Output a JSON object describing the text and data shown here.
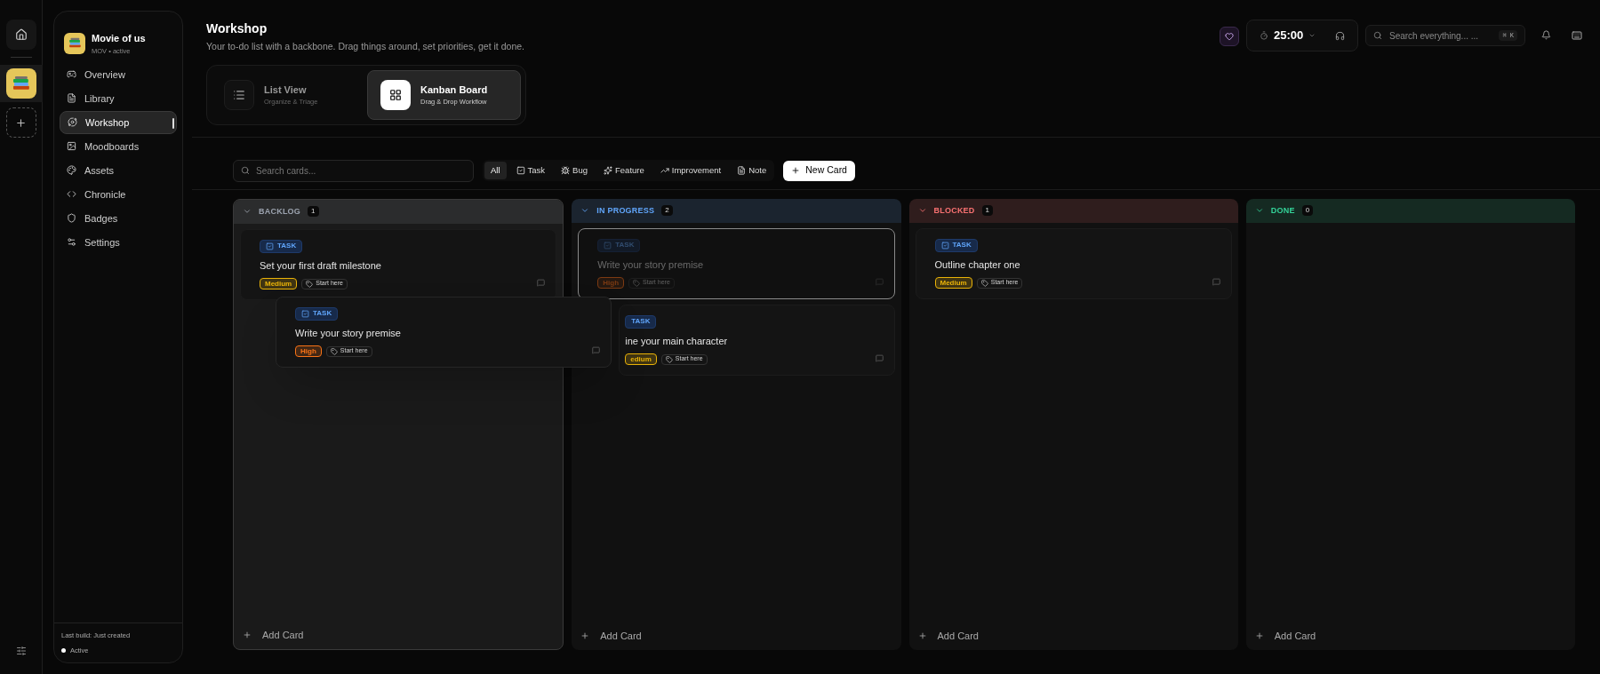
{
  "rail": {
    "items": [
      {
        "kind": "home",
        "selected": false
      },
      {
        "kind": "project",
        "selected": true
      },
      {
        "kind": "add",
        "selected": false
      }
    ]
  },
  "sidebar": {
    "project": {
      "name": "Movie of us",
      "subtitle": "MOV • active"
    },
    "items": [
      {
        "label": "Overview",
        "selected": false
      },
      {
        "label": "Library",
        "selected": false
      },
      {
        "label": "Workshop",
        "selected": true
      },
      {
        "label": "Moodboards",
        "selected": false
      },
      {
        "label": "Assets",
        "selected": false
      },
      {
        "label": "Chronicle",
        "selected": false
      },
      {
        "label": "Badges",
        "selected": false
      },
      {
        "label": "Settings",
        "selected": false
      }
    ],
    "footer": {
      "build": "Last build: Just created",
      "status": "Active"
    }
  },
  "header": {
    "title": "Workshop",
    "subtitle": "Your to-do list with a backbone. Drag things around, set priorities, get it done."
  },
  "views": [
    {
      "title": "List View",
      "subtitle": "Organize & Triage",
      "selected": false
    },
    {
      "title": "Kanban Board",
      "subtitle": "Drag & Drop Workflow",
      "selected": true
    }
  ],
  "topbar": {
    "timer": "25:00",
    "search_placeholder": "Search everything... ...",
    "shortcut": "⌘ K"
  },
  "toolbar": {
    "search_placeholder": "Search cards...",
    "filters": [
      {
        "label": "All",
        "selected": true
      },
      {
        "label": "Task",
        "selected": false
      },
      {
        "label": "Bug",
        "selected": false
      },
      {
        "label": "Feature",
        "selected": false
      },
      {
        "label": "Improvement",
        "selected": false
      },
      {
        "label": "Note",
        "selected": false
      }
    ],
    "new_card": "New Card"
  },
  "columns": [
    {
      "title": "BACKLOG",
      "count": "1",
      "color": "#9ca3af",
      "drop_target": true,
      "add_label": "Add Card",
      "cards": [
        {
          "type": "TASK",
          "title": "Set your first draft milestone",
          "priority": "Medium",
          "color": "#eab308",
          "tag": "Start here",
          "ghost": false,
          "covered": false
        }
      ]
    },
    {
      "title": "IN PROGRESS",
      "count": "2",
      "color": "#60a5fa",
      "drop_target": false,
      "add_label": "Add Card",
      "cards": [
        {
          "type": "TASK",
          "title": "Write your story premise",
          "priority": "High",
          "color": "#7c3a12",
          "tag": "Start here",
          "ghost": true,
          "covered": false
        },
        {
          "type": "TASK",
          "title": "ine your main character",
          "priority": "edium",
          "color": "#eab308",
          "tag": "Start here",
          "ghost": false,
          "covered": true
        }
      ]
    },
    {
      "title": "BLOCKED",
      "count": "1",
      "color": "#f87171",
      "drop_target": false,
      "add_label": "Add Card",
      "cards": [
        {
          "type": "TASK",
          "title": "Outline chapter one",
          "priority": "Medium",
          "color": "#eab308",
          "tag": "Start here",
          "ghost": false,
          "covered": false
        }
      ]
    },
    {
      "title": "DONE",
      "count": "0",
      "color": "#34d399",
      "drop_target": false,
      "add_label": "Add Card"
    }
  ],
  "drag_card": {
    "type": "TASK",
    "title": "Write your story premise",
    "priority": "High",
    "color": "#f97316",
    "tag": "Start here"
  }
}
